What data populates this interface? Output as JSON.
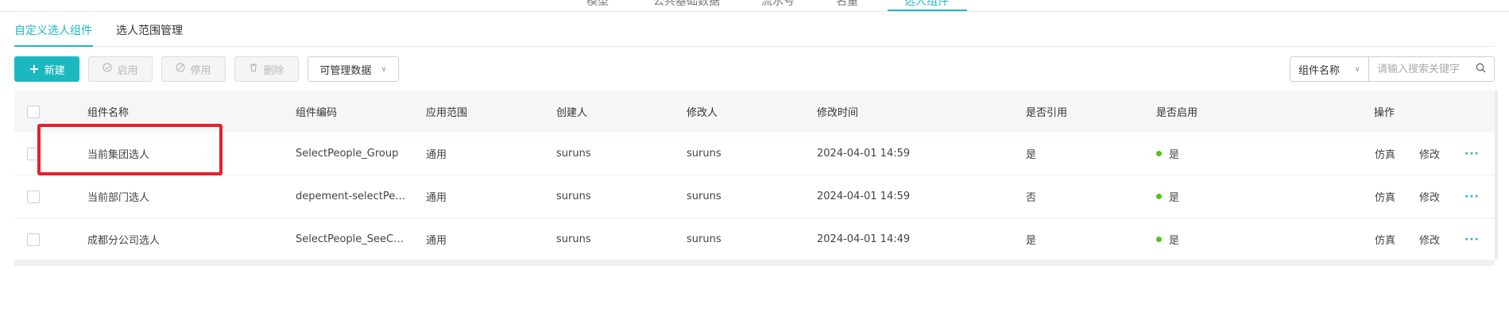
{
  "top_nav": {
    "items": [
      {
        "label": "模型"
      },
      {
        "label": "公共基础数据"
      },
      {
        "label": "流水号"
      },
      {
        "label": "名量"
      },
      {
        "label": "选人组件"
      }
    ]
  },
  "sub_tabs": [
    {
      "label": "自定义选人组件",
      "active": true
    },
    {
      "label": "选人范围管理",
      "active": false
    }
  ],
  "toolbar": {
    "new_label": "新建",
    "enable_label": "启用",
    "disable_label": "停用",
    "delete_label": "删除",
    "manage_select_value": "可管理数据",
    "search_type_value": "组件名称",
    "search_placeholder": "请输入搜索关键字"
  },
  "table": {
    "columns": [
      "组件名称",
      "组件编码",
      "应用范围",
      "创建人",
      "修改人",
      "修改时间",
      "是否引用",
      "是否启用",
      "操作"
    ],
    "rows": [
      {
        "name": "当前集团选人",
        "code": "SelectPeople_Group",
        "scope": "通用",
        "creator": "suruns",
        "modifier": "suruns",
        "modified_time": "2024-04-01 14:59",
        "referenced": "是",
        "enabled": "是",
        "action_simulate": "仿真",
        "action_edit": "修改"
      },
      {
        "name": "当前部门选人",
        "code": "depement-selectPeople",
        "scope": "通用",
        "creator": "suruns",
        "modifier": "suruns",
        "modified_time": "2024-04-01 14:59",
        "referenced": "否",
        "enabled": "是",
        "action_simulate": "仿真",
        "action_edit": "修改"
      },
      {
        "name": "成都分公司选人",
        "code": "SelectPeople_SeeCompany",
        "scope": "通用",
        "creator": "suruns",
        "modifier": "suruns",
        "modified_time": "2024-04-01 14:49",
        "referenced": "是",
        "enabled": "是",
        "action_simulate": "仿真",
        "action_edit": "修改"
      }
    ]
  },
  "colors": {
    "accent": "#1cb8c0",
    "enabled_dot": "#52c41a",
    "highlight_box": "#e5202e"
  }
}
